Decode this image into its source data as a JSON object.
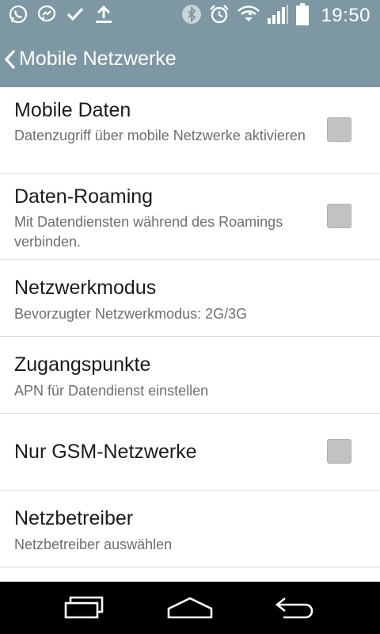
{
  "status_bar": {
    "time": "19:50",
    "notification_icons": [
      "whatsapp-icon",
      "messenger-icon",
      "checkmark-icon",
      "download-icon"
    ],
    "system_icons": [
      "bluetooth-icon",
      "alarm-icon",
      "wifi-icon",
      "signal-icon",
      "battery-icon"
    ]
  },
  "app_bar": {
    "title": "Mobile Netzwerke",
    "back_icon": "chevron-left-icon"
  },
  "settings": [
    {
      "title": "Mobile Daten",
      "subtitle": "Datenzugriff über mobile Netzwerke aktivieren",
      "checkbox": false
    },
    {
      "title": "Daten-Roaming",
      "subtitle": "Mit Datendiensten während des Roamings verbinden.",
      "checkbox": false
    },
    {
      "title": "Netzwerkmodus",
      "subtitle": "Bevorzugter Netzwerkmodus: 2G/3G"
    },
    {
      "title": "Zugangspunkte",
      "subtitle": "APN für Datendienst einstellen"
    },
    {
      "title": "Nur GSM-Netzwerke",
      "checkbox": false
    },
    {
      "title": "Netzbetreiber",
      "subtitle": "Netzbetreiber auswählen"
    }
  ],
  "nav_bar": {
    "buttons": [
      "recent-apps-icon",
      "home-icon",
      "back-icon"
    ]
  },
  "colors": {
    "header": "#7e98a3",
    "checkbox": "#c2c2c2",
    "nav_bar": "#000000"
  }
}
